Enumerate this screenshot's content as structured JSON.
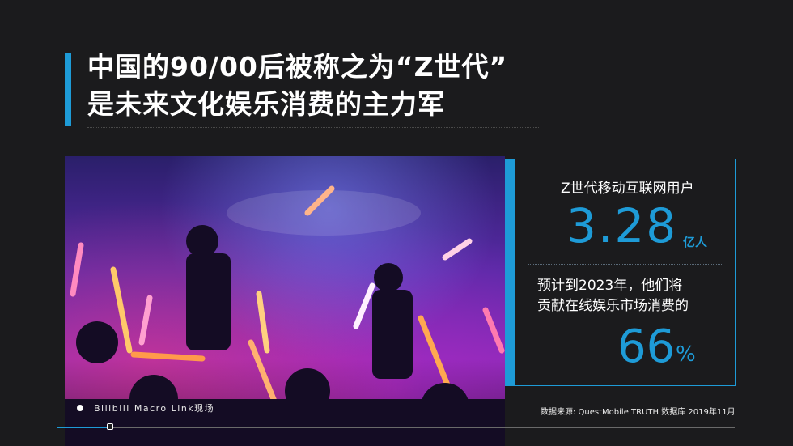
{
  "title": {
    "line1": "中国的90/00后被称之为“Z世代”",
    "line2": "是未来文化娱乐消费的主力军"
  },
  "photo": {
    "caption": "Bilibili Macro Link现场"
  },
  "stat": {
    "label": "Z世代移动互联网用户",
    "value": "3.28",
    "unit": "亿人"
  },
  "forecast": {
    "line1": "预计到2023年，他们将",
    "line2": "贡献在线娱乐市场消费的",
    "value": "66",
    "unit": "%"
  },
  "source": "数据来源: QuestMobile TRUTH 数据库 2019年11月",
  "progress": {
    "fraction": 0.079
  },
  "colors": {
    "accent": "#1e9bd7",
    "background": "#1b1b1d"
  }
}
